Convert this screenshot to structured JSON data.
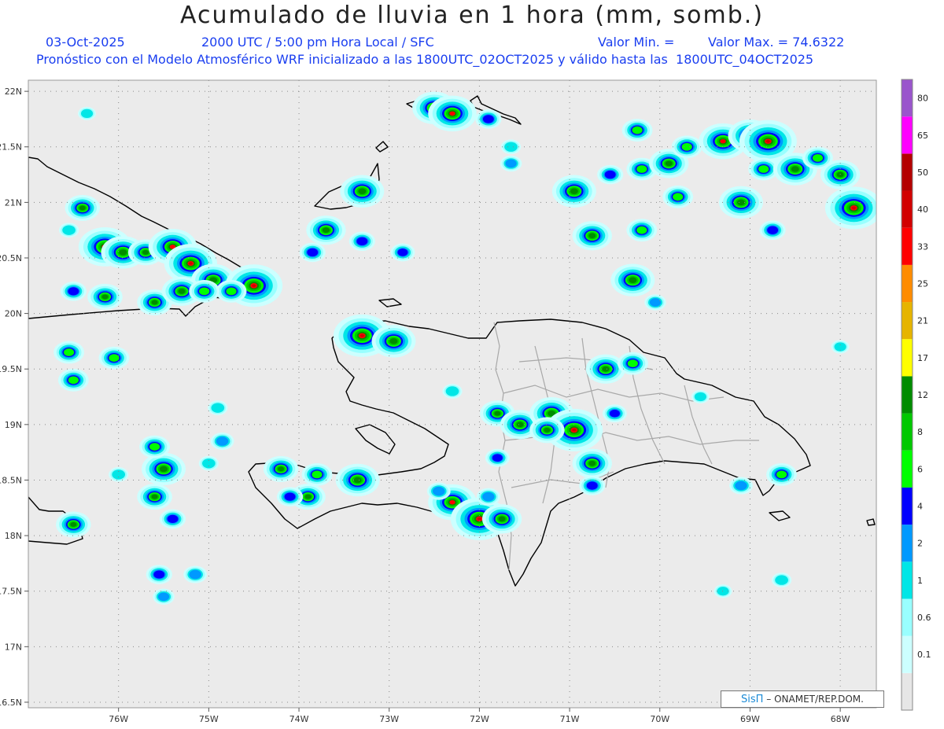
{
  "header": {
    "title": "Acumulado de lluvia en 1 hora (mm, somb.)",
    "date": "03-Oct-2025",
    "time": "2000 UTC / 5:00 pm Hora Local / SFC",
    "min_label": "Valor Min. =",
    "max_label": "Valor Max. = 74.6322",
    "forecast": "Pronóstico con el Modelo Atmosférico WRF inicializado a las 1800UTC_02OCT2025 y válido hasta las  1800UTC_04OCT2025"
  },
  "map": {
    "lon_labels": [
      "76W",
      "75W",
      "74W",
      "73W",
      "72W",
      "71W",
      "70W",
      "69W",
      "68W"
    ],
    "lon_values": [
      -76,
      -75,
      -74,
      -73,
      -72,
      -71,
      -70,
      -69,
      -68
    ],
    "lat_labels": [
      "22N",
      "21.5N",
      "21N",
      "20.5N",
      "20N",
      "19.5N",
      "19N",
      "18.5N",
      "18N",
      "17.5N",
      "17N",
      "16.5N"
    ],
    "lat_values": [
      22,
      21.5,
      21,
      20.5,
      20,
      19.5,
      19,
      18.5,
      18,
      17.5,
      17,
      16.5
    ],
    "lon_range": [
      -77.0,
      -67.6
    ],
    "lat_range": [
      16.45,
      22.1
    ],
    "colors": {
      "ocean": "#ebebeb",
      "coast": "#000000",
      "border": "#a8a8a8",
      "grid": "#888888"
    },
    "rain_cells": [
      {
        "lon": -76.35,
        "lat": 21.8,
        "a": 0.6
      },
      {
        "lon": -76.4,
        "lat": 20.95,
        "a": 2.5
      },
      {
        "lon": -76.55,
        "lat": 20.75,
        "a": 0.8
      },
      {
        "lon": -76.15,
        "lat": 20.6,
        "a": 4.5
      },
      {
        "lon": -75.95,
        "lat": 20.55,
        "a": 3.5
      },
      {
        "lon": -75.7,
        "lat": 20.55,
        "a": 2.5
      },
      {
        "lon": -75.4,
        "lat": 20.6,
        "a": 4
      },
      {
        "lon": -75.2,
        "lat": 20.45,
        "a": 4.5
      },
      {
        "lon": -74.95,
        "lat": 20.3,
        "a": 3.5
      },
      {
        "lon": -74.5,
        "lat": 20.25,
        "a": 5
      },
      {
        "lon": -74.75,
        "lat": 20.2,
        "a": 2
      },
      {
        "lon": -75.6,
        "lat": 20.1,
        "a": 2.5
      },
      {
        "lon": -75.3,
        "lat": 20.2,
        "a": 3
      },
      {
        "lon": -76.15,
        "lat": 20.15,
        "a": 2.5
      },
      {
        "lon": -76.5,
        "lat": 20.2,
        "a": 1.5
      },
      {
        "lon": -76.55,
        "lat": 19.65,
        "a": 2
      },
      {
        "lon": -76.5,
        "lat": 19.4,
        "a": 2
      },
      {
        "lon": -76.05,
        "lat": 19.6,
        "a": 2
      },
      {
        "lon": -75.05,
        "lat": 20.2,
        "a": 2
      },
      {
        "lon": -73.3,
        "lat": 21.1,
        "a": 3.5
      },
      {
        "lon": -73.7,
        "lat": 20.75,
        "a": 3
      },
      {
        "lon": -73.3,
        "lat": 20.65,
        "a": 1.5
      },
      {
        "lon": -73.85,
        "lat": 20.55,
        "a": 1.5
      },
      {
        "lon": -72.85,
        "lat": 20.55,
        "a": 1.3
      },
      {
        "lon": -72.5,
        "lat": 21.85,
        "a": 3.5
      },
      {
        "lon": -72.3,
        "lat": 21.8,
        "a": 4
      },
      {
        "lon": -71.9,
        "lat": 21.75,
        "a": 1.5
      },
      {
        "lon": -71.65,
        "lat": 21.35,
        "a": 1
      },
      {
        "lon": -71.65,
        "lat": 21.5,
        "a": 0.8
      },
      {
        "lon": -70.95,
        "lat": 21.1,
        "a": 3.5
      },
      {
        "lon": -70.75,
        "lat": 20.7,
        "a": 3
      },
      {
        "lon": -70.2,
        "lat": 20.75,
        "a": 2
      },
      {
        "lon": -70.55,
        "lat": 21.25,
        "a": 1.5
      },
      {
        "lon": -70.2,
        "lat": 21.3,
        "a": 2
      },
      {
        "lon": -69.9,
        "lat": 21.35,
        "a": 3
      },
      {
        "lon": -69.7,
        "lat": 21.5,
        "a": 2
      },
      {
        "lon": -69.3,
        "lat": 21.55,
        "a": 4
      },
      {
        "lon": -69.0,
        "lat": 21.6,
        "a": 3.5
      },
      {
        "lon": -68.8,
        "lat": 21.55,
        "a": 5
      },
      {
        "lon": -69.1,
        "lat": 21.0,
        "a": 3.5
      },
      {
        "lon": -69.8,
        "lat": 21.05,
        "a": 2
      },
      {
        "lon": -68.85,
        "lat": 21.3,
        "a": 2
      },
      {
        "lon": -68.5,
        "lat": 21.3,
        "a": 3.5
      },
      {
        "lon": -68.25,
        "lat": 21.4,
        "a": 2
      },
      {
        "lon": -68.0,
        "lat": 21.25,
        "a": 3
      },
      {
        "lon": -67.85,
        "lat": 20.95,
        "a": 5
      },
      {
        "lon": -68.75,
        "lat": 20.75,
        "a": 1.5
      },
      {
        "lon": -70.25,
        "lat": 21.65,
        "a": 2
      },
      {
        "lon": -70.3,
        "lat": 20.3,
        "a": 3.5
      },
      {
        "lon": -70.05,
        "lat": 20.1,
        "a": 1
      },
      {
        "lon": -73.3,
        "lat": 19.8,
        "a": 5
      },
      {
        "lon": -72.95,
        "lat": 19.75,
        "a": 3.5
      },
      {
        "lon": -72.3,
        "lat": 19.3,
        "a": 0.8
      },
      {
        "lon": -71.8,
        "lat": 19.1,
        "a": 2.5
      },
      {
        "lon": -71.55,
        "lat": 19.0,
        "a": 3
      },
      {
        "lon": -71.2,
        "lat": 19.1,
        "a": 3.5
      },
      {
        "lon": -70.95,
        "lat": 18.95,
        "a": 5
      },
      {
        "lon": -70.6,
        "lat": 19.5,
        "a": 3
      },
      {
        "lon": -70.3,
        "lat": 19.55,
        "a": 2
      },
      {
        "lon": -70.5,
        "lat": 19.1,
        "a": 1.3
      },
      {
        "lon": -71.25,
        "lat": 18.95,
        "a": 2.5
      },
      {
        "lon": -70.75,
        "lat": 18.65,
        "a": 3
      },
      {
        "lon": -70.75,
        "lat": 18.45,
        "a": 1.5
      },
      {
        "lon": -71.8,
        "lat": 18.7,
        "a": 1.3
      },
      {
        "lon": -74.2,
        "lat": 18.6,
        "a": 2.5
      },
      {
        "lon": -73.8,
        "lat": 18.55,
        "a": 2
      },
      {
        "lon": -73.35,
        "lat": 18.5,
        "a": 3.5
      },
      {
        "lon": -73.9,
        "lat": 18.35,
        "a": 2.5
      },
      {
        "lon": -74.1,
        "lat": 18.35,
        "a": 1.5
      },
      {
        "lon": -72.3,
        "lat": 18.3,
        "a": 4
      },
      {
        "lon": -72.0,
        "lat": 18.15,
        "a": 5
      },
      {
        "lon": -71.75,
        "lat": 18.15,
        "a": 3
      },
      {
        "lon": -72.45,
        "lat": 18.4,
        "a": 1.2
      },
      {
        "lon": -71.9,
        "lat": 18.35,
        "a": 1.2
      },
      {
        "lon": -68.65,
        "lat": 18.55,
        "a": 2
      },
      {
        "lon": -69.1,
        "lat": 18.45,
        "a": 1.2
      },
      {
        "lon": -75.5,
        "lat": 18.6,
        "a": 3.5
      },
      {
        "lon": -75.6,
        "lat": 18.35,
        "a": 2.5
      },
      {
        "lon": -75.6,
        "lat": 18.8,
        "a": 2
      },
      {
        "lon": -75.4,
        "lat": 18.15,
        "a": 1.5
      },
      {
        "lon": -75.55,
        "lat": 17.65,
        "a": 1.5
      },
      {
        "lon": -75.15,
        "lat": 17.65,
        "a": 1.2
      },
      {
        "lon": -75.5,
        "lat": 17.45,
        "a": 1
      },
      {
        "lon": -74.85,
        "lat": 18.85,
        "a": 1.2
      },
      {
        "lon": -76.0,
        "lat": 18.55,
        "a": 0.8
      },
      {
        "lon": -76.5,
        "lat": 18.1,
        "a": 2.5
      },
      {
        "lon": -75.0,
        "lat": 18.65,
        "a": 0.8
      },
      {
        "lon": -74.9,
        "lat": 19.15,
        "a": 0.8
      },
      {
        "lon": -68.65,
        "lat": 17.6,
        "a": 0.8
      },
      {
        "lon": -69.3,
        "lat": 17.5,
        "a": 0.6
      },
      {
        "lon": -68.0,
        "lat": 19.7,
        "a": 0.6
      },
      {
        "lon": -69.55,
        "lat": 19.25,
        "a": 0.6
      }
    ]
  },
  "colorbar": {
    "colors": [
      "#e6e6e6",
      "#ccffff",
      "#99ffff",
      "#00e6e6",
      "#0099ff",
      "#0000ff",
      "#00ff00",
      "#00c800",
      "#008c00",
      "#ffff00",
      "#e6b400",
      "#ff8c00",
      "#ff0000",
      "#d20000",
      "#b40000",
      "#ff00ff",
      "#9a55cc"
    ],
    "labels": [
      "0.1",
      "0.6",
      "1",
      "2",
      "4",
      "6",
      "8",
      "12",
      "17",
      "21",
      "25",
      "33",
      "40",
      "50",
      "65",
      "80"
    ]
  },
  "credit": {
    "brand": "SisΠ",
    "text": "– ONAMET/REP.DOM."
  }
}
